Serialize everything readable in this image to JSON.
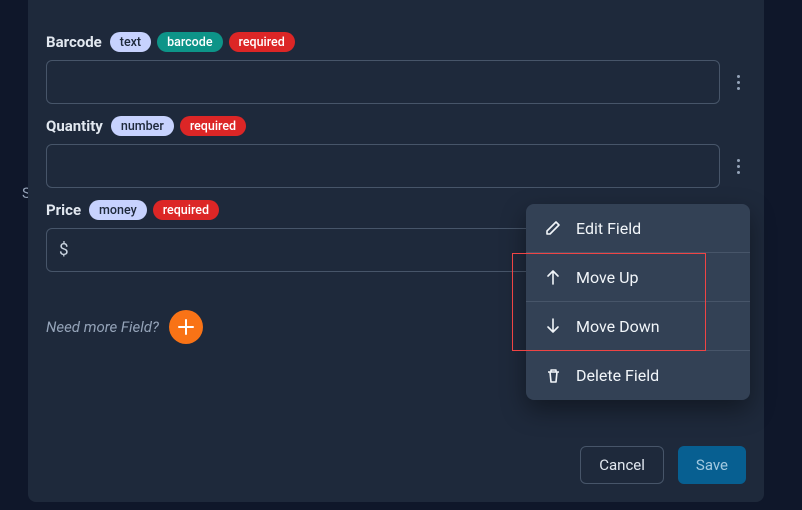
{
  "fields": [
    {
      "label": "Barcode",
      "tags": {
        "type": "text",
        "subtype": "barcode",
        "required": "required"
      }
    },
    {
      "label": "Quantity",
      "tags": {
        "type": "number",
        "required": "required"
      }
    },
    {
      "label": "Price",
      "tags": {
        "type": "money",
        "required": "required"
      },
      "prefix": "$"
    }
  ],
  "need_more_text": "Need more Field?",
  "buttons": {
    "cancel": "Cancel",
    "save": "Save"
  },
  "dropdown": {
    "edit": "Edit Field",
    "move_up": "Move Up",
    "move_down": "Move Down",
    "delete": "Delete Field"
  },
  "stray_char": "S"
}
